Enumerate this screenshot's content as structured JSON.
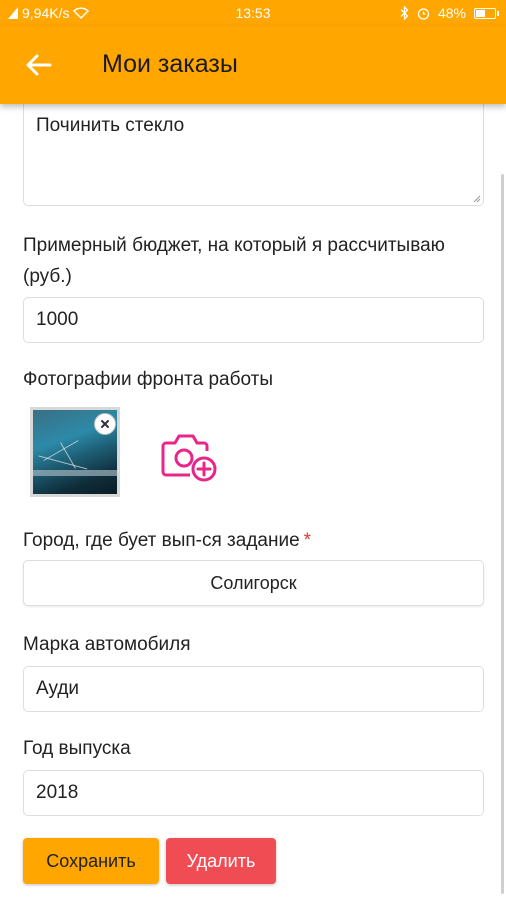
{
  "status_bar": {
    "network_speed": "9,94K/s",
    "time": "13:53",
    "battery_percent": "48%",
    "battery_level": 0.48
  },
  "app_bar": {
    "title": "Мои заказы"
  },
  "form": {
    "description_value": "Починить стекло",
    "budget_label": "Примерный бюджет, на который я рассчитываю (руб.)",
    "budget_value": "1000",
    "photos_label": "Фотографии фронта работы",
    "city_label": "Город, где бует вып-ся задание",
    "city_required_mark": "*",
    "city_value": "Солигорск",
    "car_brand_label": "Марка автомобиля",
    "car_brand_value": "Ауди",
    "year_label": "Год выпуска",
    "year_value": "2018"
  },
  "buttons": {
    "save_label": "Сохранить",
    "delete_label": "Удалить"
  },
  "colors": {
    "accent": "#ffa600",
    "danger": "#f04c54",
    "camera_icon": "#e8268a"
  },
  "icons": [
    "back-arrow-icon",
    "close-icon",
    "add-photo-icon",
    "wifi-icon",
    "bluetooth-icon",
    "battery-icon",
    "signal-icon"
  ]
}
